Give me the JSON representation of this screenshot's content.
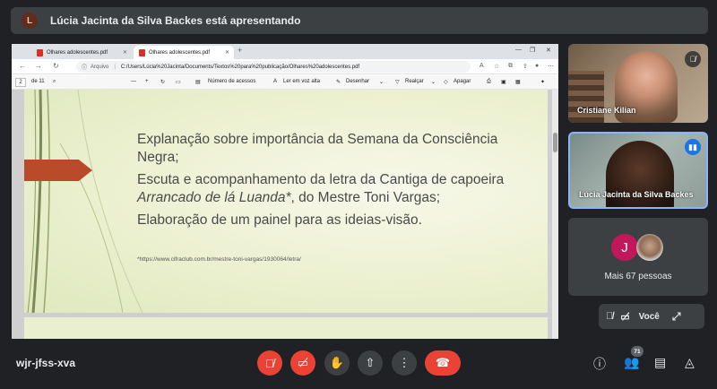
{
  "presenter_banner": {
    "avatar_letter": "L",
    "text": "Lúcia Jacinta da Silva Backes está apresentando"
  },
  "browser": {
    "tabs": [
      {
        "label": "Olhares adolescentes.pdf"
      },
      {
        "label": "Olhares adolescentes.pdf"
      }
    ],
    "address_label": "Arquivo",
    "url": "C:/Users/Lúcia%20Jacinta/Documents/Textos%20para%20publicação/Olhares%20adolescentes.pdf"
  },
  "pdf_toolbar": {
    "page_current": "2",
    "page_total": "de 11",
    "page_view": "Número de acessos",
    "read_aloud": "Ler em voz alta",
    "draw": "Desenhar",
    "highlight": "Realçar",
    "erase": "Apagar"
  },
  "slide": {
    "paragraphs": [
      "Explanação sobre importância da Semana da Consciência Negra;",
      "Escuta e acompanhamento da letra da Cantiga de capoeira",
      "Arrancado de lá Luanda*",
      ", do Mestre Toni Vargas;",
      "Elaboração de um painel para as ideias-visão."
    ],
    "footnote": "*https://www.cifraclub.com.br/mestre-toni-vargas/1930064/letra/"
  },
  "participants": [
    {
      "name": "Cristiane Kilian",
      "mic": "muted"
    },
    {
      "name": "Lúcia Jacinta da Silva Backes",
      "mic": "speaking"
    }
  ],
  "more": {
    "avatar_letter": "J",
    "text": "Mais 67 pessoas"
  },
  "self_tile": {
    "name": "Você"
  },
  "bottom_bar": {
    "meeting_code": "wjr-jfss-xva",
    "participant_count": "71"
  },
  "colors": {
    "accent_red": "#ea4335",
    "speaking_blue": "#1a73e8",
    "slide_arrow": "#b94a2a"
  }
}
